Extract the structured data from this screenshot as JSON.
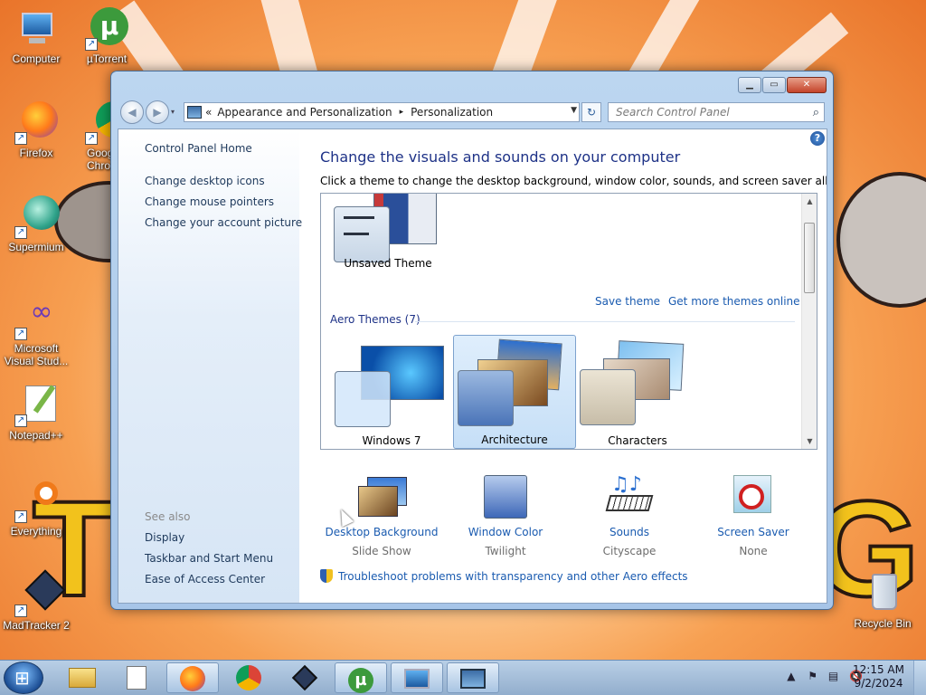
{
  "desktop": {
    "icons": [
      {
        "label": "Computer"
      },
      {
        "label": "µTorrent"
      },
      {
        "label": "Firefox"
      },
      {
        "label": "Goog\nChro"
      },
      {
        "label": "Supermium"
      },
      {
        "label": "Microsoft\nVisual Stud..."
      },
      {
        "label": "Notepad++"
      },
      {
        "label": "Everything"
      },
      {
        "label": "MadTracker 2"
      },
      {
        "label": "Recycle Bin"
      }
    ]
  },
  "window": {
    "address": {
      "prefix": "«",
      "crumb1": "Appearance and Personalization",
      "sep": "▸",
      "crumb2": "Personalization"
    },
    "search_placeholder": "Search Control Panel",
    "left": {
      "home": "Control Panel Home",
      "links": [
        "Change desktop icons",
        "Change mouse pointers",
        "Change your account picture"
      ],
      "see_also": "See also",
      "see_links": [
        "Display",
        "Taskbar and Start Menu",
        "Ease of Access Center"
      ]
    },
    "heading": "Change the visuals and sounds on your computer",
    "subheading": "Click a theme to change the desktop background, window color, sounds, and screen saver all at once.",
    "themes": {
      "unsaved": "Unsaved Theme",
      "save_theme": "Save theme",
      "get_more": "Get more themes online",
      "group": "Aero Themes (7)",
      "items": [
        "Windows 7",
        "Architecture",
        "Characters"
      ]
    },
    "bottom": [
      {
        "title": "Desktop Background",
        "sub": "Slide Show"
      },
      {
        "title": "Window Color",
        "sub": "Twilight"
      },
      {
        "title": "Sounds",
        "sub": "Cityscape"
      },
      {
        "title": "Screen Saver",
        "sub": "None"
      }
    ],
    "troubleshoot": "Troubleshoot problems with transparency and other Aero effects"
  },
  "taskbar": {
    "time": "12:15 AM",
    "date": "9/2/2024",
    "tray_icons": [
      "show-hidden-icon",
      "flag-icon",
      "network-icon",
      "volume-muted-icon"
    ]
  },
  "colors": {
    "link": "#1a5bb0",
    "heading": "#1e3287",
    "selected_tile": "#c6dff7"
  }
}
